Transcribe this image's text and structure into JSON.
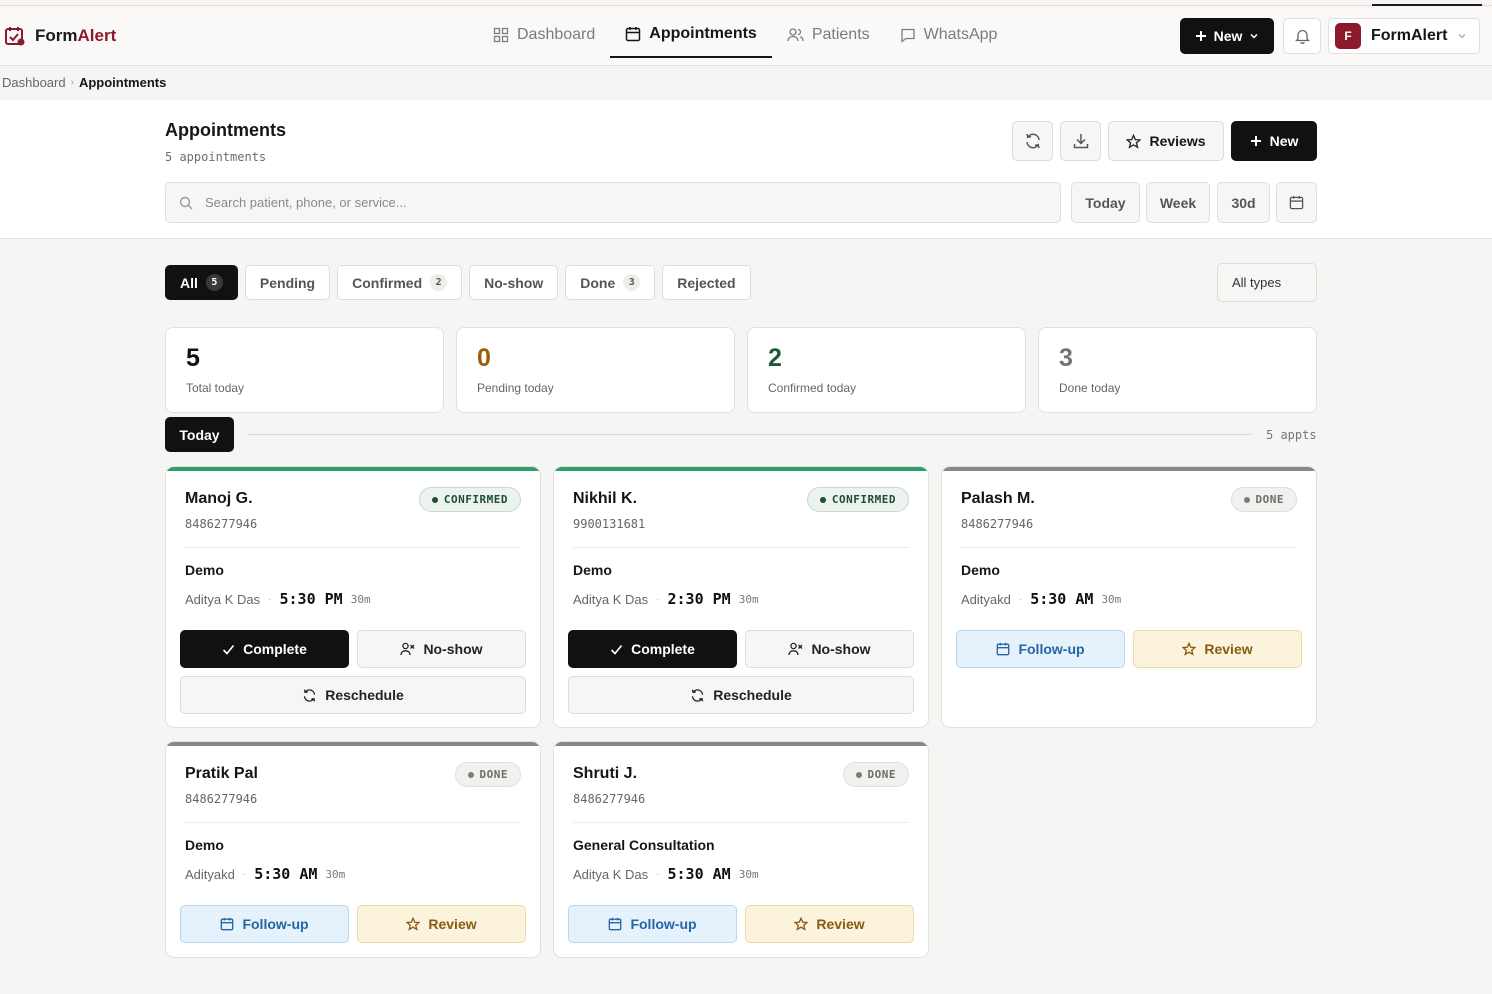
{
  "app": {
    "brand_part1": "Form",
    "brand_part2": "Alert",
    "nav": [
      {
        "label": "Dashboard",
        "icon": "grid-icon"
      },
      {
        "label": "Appointments",
        "icon": "calendar-icon",
        "active": true
      },
      {
        "label": "Patients",
        "icon": "users-icon"
      },
      {
        "label": "WhatsApp",
        "icon": "chat-icon"
      }
    ],
    "new_label": "New",
    "user_initial": "F",
    "user_name": "FormAlert"
  },
  "breadcrumb": {
    "root": "Dashboard",
    "current": "Appointments"
  },
  "header": {
    "title": "Appointments",
    "subtitle": "5 appointments",
    "reviews_label": "Reviews",
    "new_label": "New",
    "search_placeholder": "Search patient, phone, or service...",
    "ranges": [
      "Today",
      "Week",
      "30d"
    ]
  },
  "filters": {
    "chips": [
      {
        "label": "All",
        "count": "5",
        "active": true
      },
      {
        "label": "Pending",
        "count": ""
      },
      {
        "label": "Confirmed",
        "count": "2"
      },
      {
        "label": "No-show",
        "count": ""
      },
      {
        "label": "Done",
        "count": "3"
      },
      {
        "label": "Rejected",
        "count": ""
      }
    ],
    "type_select": "All types"
  },
  "stats": [
    {
      "value": "5",
      "label": "Total today",
      "color": "#111111"
    },
    {
      "value": "0",
      "label": "Pending today",
      "color": "#9a5d0c"
    },
    {
      "value": "2",
      "label": "Confirmed today",
      "color": "#1f5a36"
    },
    {
      "value": "3",
      "label": "Done today",
      "color": "#77746f"
    }
  ],
  "day_group": {
    "label": "Today",
    "count": "5 appts"
  },
  "actions": {
    "complete": "Complete",
    "noshow": "No-show",
    "reschedule": "Reschedule",
    "followup": "Follow-up",
    "review": "Review"
  },
  "appointments": [
    {
      "name": "Manoj G.",
      "phone": "8486277946",
      "status": "CONFIRMED",
      "service": "Demo",
      "provider": "Aditya K Das",
      "time": "5:30 PM",
      "duration": "30m"
    },
    {
      "name": "Nikhil K.",
      "phone": "9900131681",
      "status": "CONFIRMED",
      "service": "Demo",
      "provider": "Aditya K Das",
      "time": "2:30 PM",
      "duration": "30m"
    },
    {
      "name": "Palash M.",
      "phone": "8486277946",
      "status": "DONE",
      "service": "Demo",
      "provider": "Adityakd",
      "time": "5:30 AM",
      "duration": "30m"
    },
    {
      "name": "Pratik Pal",
      "phone": "8486277946",
      "status": "DONE",
      "service": "Demo",
      "provider": "Adityakd",
      "time": "5:30 AM",
      "duration": "30m"
    },
    {
      "name": "Shruti J.",
      "phone": "8486277946",
      "status": "DONE",
      "service": "General Consultation",
      "provider": "Aditya K Das",
      "time": "5:30 AM",
      "duration": "30m"
    }
  ],
  "colors": {
    "confirmed_bar": "#2e9e6e",
    "done_bar": "#8a8884",
    "brand": "#8b1a2c"
  }
}
